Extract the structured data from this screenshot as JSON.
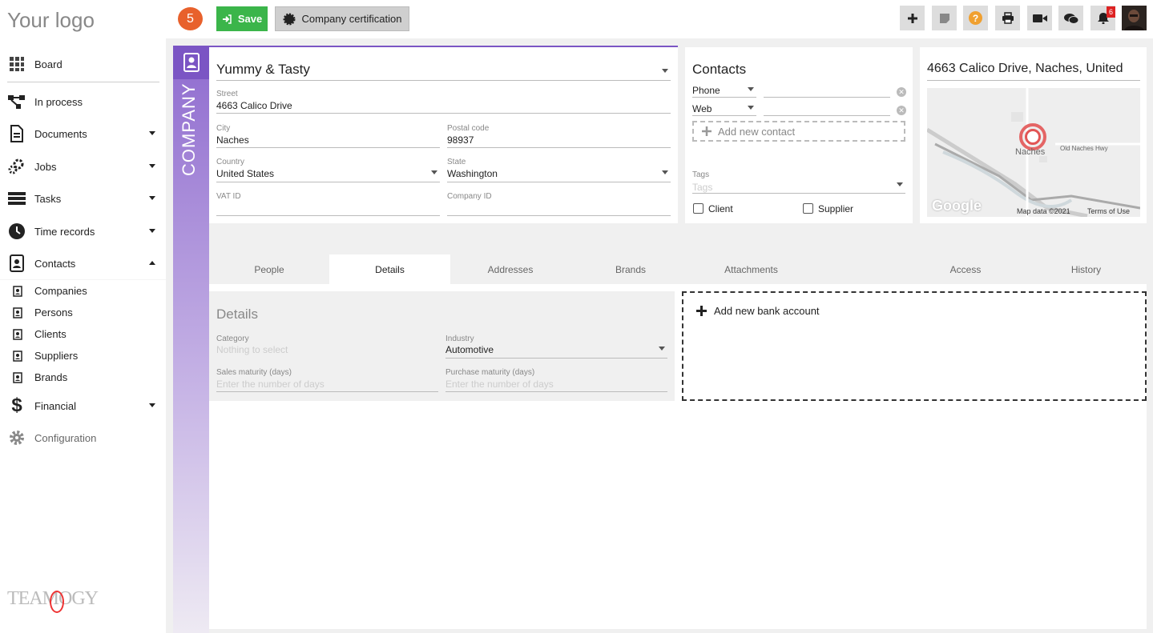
{
  "app": {
    "logo": "Your logo",
    "notification_count_badge": "5",
    "bell_count": "6"
  },
  "toolbar": {
    "save_label": "Save",
    "cert_label": "Company certification"
  },
  "sidebar": {
    "items": [
      {
        "label": "Board",
        "icon": "grid-icon"
      },
      {
        "label": "In process",
        "icon": "flow-icon"
      },
      {
        "label": "Documents",
        "icon": "document-icon"
      },
      {
        "label": "Jobs",
        "icon": "gears-icon"
      },
      {
        "label": "Tasks",
        "icon": "tasks-icon"
      },
      {
        "label": "Time records",
        "icon": "clock-icon"
      },
      {
        "label": "Contacts",
        "icon": "contacts-icon"
      },
      {
        "label": "Financial",
        "icon": "dollar-icon"
      },
      {
        "label": "Configuration",
        "icon": "gear-icon"
      }
    ],
    "subitems": [
      "Companies",
      "Persons",
      "Clients",
      "Suppliers",
      "Brands"
    ],
    "footer_logo": "TEAMOGY"
  },
  "company": {
    "stripe_label": "COMPANY",
    "name": "Yummy & Tasty",
    "street_label": "Street",
    "street": "4663 Calico Drive",
    "city_label": "City",
    "city": "Naches",
    "postal_label": "Postal code",
    "postal": "98937",
    "country_label": "Country",
    "country": "United States",
    "state_label": "State",
    "state": "Washington",
    "vat_label": "VAT ID",
    "vat": "",
    "companyid_label": "Company ID",
    "companyid": ""
  },
  "contacts": {
    "title": "Contacts",
    "phone_label": "Phone",
    "web_label": "Web",
    "add_label": "Add new contact",
    "tags_label": "Tags",
    "tags_placeholder": "Tags",
    "client_label": "Client",
    "supplier_label": "Supplier"
  },
  "map": {
    "title": "4663 Calico Drive, Naches, United",
    "town": "Naches",
    "road": "Old Naches Hwy",
    "google": "Google",
    "attribution": "Map data ©2021",
    "terms": "Terms of Use"
  },
  "tabs": [
    "People",
    "Details",
    "Addresses",
    "Brands",
    "Attachments",
    "Access",
    "History"
  ],
  "details": {
    "title": "Details",
    "category_label": "Category",
    "category_placeholder": "Nothing to select",
    "industry_label": "Industry",
    "industry": "Automotive",
    "sales_label": "Sales maturity (days)",
    "sales_placeholder": "Enter the number of days",
    "purchase_label": "Purchase maturity (days)",
    "purchase_placeholder": "Enter the number of days"
  },
  "bank": {
    "add_label": "Add new bank account"
  },
  "colors": {
    "accent": "#7b55c4",
    "save": "#3bb54a",
    "badge": "#e8612c"
  }
}
